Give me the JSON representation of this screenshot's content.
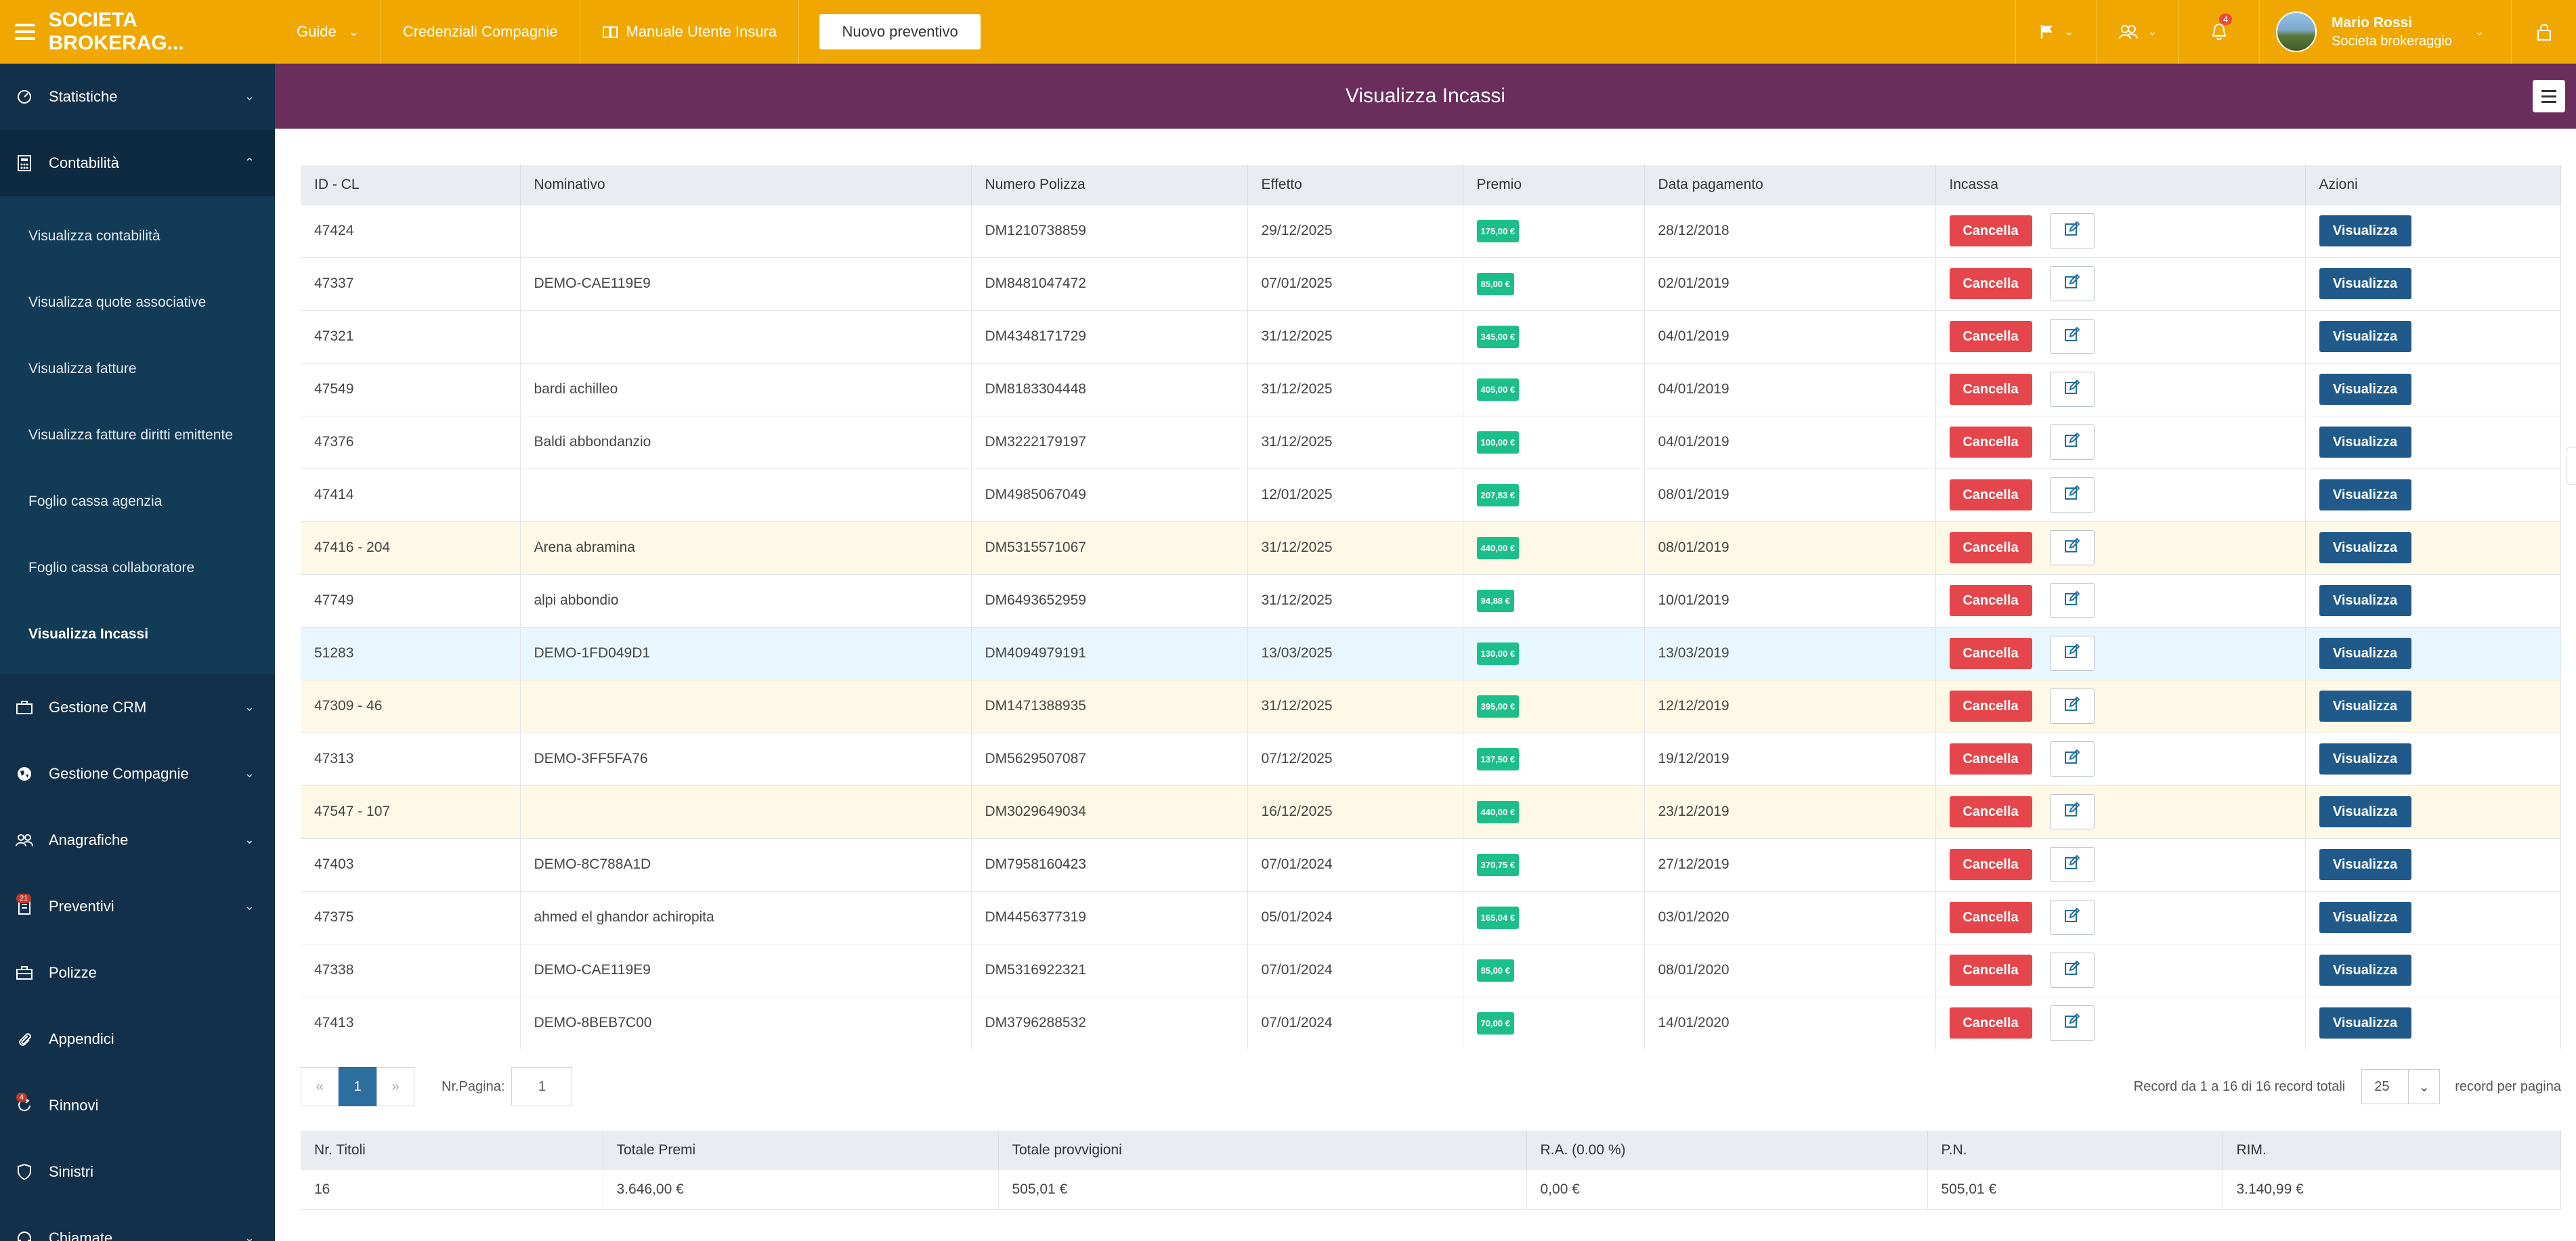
{
  "topbar": {
    "brand": "SOCIETA BROKERAG...",
    "guide": "Guide",
    "credenziali": "Credenziali Compagnie",
    "manuale": "Manuale Utente Insura",
    "nuovo": "Nuovo preventivo",
    "notif_count": "4",
    "user_name": "Mario Rossi",
    "user_role": "Societa brokeraggio",
    "accent": "#f0a800"
  },
  "sidebar": {
    "statistiche": "Statistiche",
    "contabilita": "Contabilità",
    "sub": [
      "Visualizza contabilità",
      "Visualizza quote associative",
      "Visualizza fatture",
      "Visualizza fatture diritti emittente",
      "Foglio cassa agenzia",
      "Foglio cassa collaboratore",
      "Visualizza Incassi"
    ],
    "crm": "Gestione CRM",
    "compagnie": "Gestione Compagnie",
    "anagrafiche": "Anagrafiche",
    "preventivi": "Preventivi",
    "preventivi_badge": "21",
    "polizze": "Polizze",
    "appendici": "Appendici",
    "rinnovi": "Rinnovi",
    "rinnovi_badge": "4",
    "sinistri": "Sinistri",
    "chiamate": "Chiamate"
  },
  "page": {
    "title": "Visualizza Incassi"
  },
  "table": {
    "headers": [
      "ID - CL",
      "Nominativo",
      "Numero Polizza",
      "Effetto",
      "Premio",
      "Data pagamento",
      "Incassa",
      "Azioni"
    ],
    "cancel_label": "Cancella",
    "view_label": "Visualizza",
    "rows": [
      {
        "id": "47424",
        "nome": "",
        "polizza": "DM1210738859",
        "effetto": "29/12/2025",
        "premio": "175,00 €",
        "data": "28/12/2018",
        "hl": ""
      },
      {
        "id": "47337",
        "nome": "DEMO-CAE119E9",
        "polizza": "DM8481047472",
        "effetto": "07/01/2025",
        "premio": "85,00 €",
        "data": "02/01/2019",
        "hl": ""
      },
      {
        "id": "47321",
        "nome": "",
        "polizza": "DM4348171729",
        "effetto": "31/12/2025",
        "premio": "345,00 €",
        "data": "04/01/2019",
        "hl": ""
      },
      {
        "id": "47549",
        "nome": "bardi achilleo",
        "polizza": "DM8183304448",
        "effetto": "31/12/2025",
        "premio": "405,00 €",
        "data": "04/01/2019",
        "hl": ""
      },
      {
        "id": "47376",
        "nome": "Baldi abbondanzio",
        "polizza": "DM3222179197",
        "effetto": "31/12/2025",
        "premio": "100,00 €",
        "data": "04/01/2019",
        "hl": ""
      },
      {
        "id": "47414",
        "nome": "",
        "polizza": "DM4985067049",
        "effetto": "12/01/2025",
        "premio": "207,83 €",
        "data": "08/01/2019",
        "hl": ""
      },
      {
        "id": "47416 - 204",
        "nome": "Arena abramina",
        "polizza": "DM5315571067",
        "effetto": "31/12/2025",
        "premio": "440,00 €",
        "data": "08/01/2019",
        "hl": "yellow"
      },
      {
        "id": "47749",
        "nome": "alpi abbondio",
        "polizza": "DM6493652959",
        "effetto": "31/12/2025",
        "premio": "94,88 €",
        "data": "10/01/2019",
        "hl": ""
      },
      {
        "id": "51283",
        "nome": "DEMO-1FD049D1",
        "polizza": "DM4094979191",
        "effetto": "13/03/2025",
        "premio": "130,00 €",
        "data": "13/03/2019",
        "hl": "blue"
      },
      {
        "id": "47309 - 46",
        "nome": "",
        "polizza": "DM1471388935",
        "effetto": "31/12/2025",
        "premio": "395,00 €",
        "data": "12/12/2019",
        "hl": "yellow"
      },
      {
        "id": "47313",
        "nome": "DEMO-3FF5FA76",
        "polizza": "DM5629507087",
        "effetto": "07/12/2025",
        "premio": "137,50 €",
        "data": "19/12/2019",
        "hl": ""
      },
      {
        "id": "47547 - 107",
        "nome": "",
        "polizza": "DM3029649034",
        "effetto": "16/12/2025",
        "premio": "440,00 €",
        "data": "23/12/2019",
        "hl": "yellow"
      },
      {
        "id": "47403",
        "nome": "DEMO-8C788A1D",
        "polizza": "DM7958160423",
        "effetto": "07/01/2024",
        "premio": "370,75 €",
        "data": "27/12/2019",
        "hl": ""
      },
      {
        "id": "47375",
        "nome": "ahmed el ghandor achiropita",
        "polizza": "DM4456377319",
        "effetto": "05/01/2024",
        "premio": "165,04 €",
        "data": "03/01/2020",
        "hl": ""
      },
      {
        "id": "47338",
        "nome": "DEMO-CAE119E9",
        "polizza": "DM5316922321",
        "effetto": "07/01/2024",
        "premio": "85,00 €",
        "data": "08/01/2020",
        "hl": ""
      },
      {
        "id": "47413",
        "nome": "DEMO-8BEB7C00",
        "polizza": "DM3796288532",
        "effetto": "07/01/2024",
        "premio": "70,00 €",
        "data": "14/01/2020",
        "hl": ""
      }
    ]
  },
  "pager": {
    "prev": "«",
    "page": "1",
    "next": "»",
    "nr_pagina_label": "Nr.Pagina:",
    "nr_pagina_value": "1",
    "records": "Record da 1 a 16 di 16 record totali",
    "per_page": "25",
    "per_page_label": "record per pagina"
  },
  "totals": {
    "headers": [
      "Nr. Titoli",
      "Totale Premi",
      "Totale provvigioni",
      "R.A. (0.00 %)",
      "P.N.",
      "RIM."
    ],
    "values": [
      "16",
      "3.646,00 €",
      "505,01 €",
      "0,00 €",
      "505,01 €",
      "3.140,99 €"
    ]
  }
}
